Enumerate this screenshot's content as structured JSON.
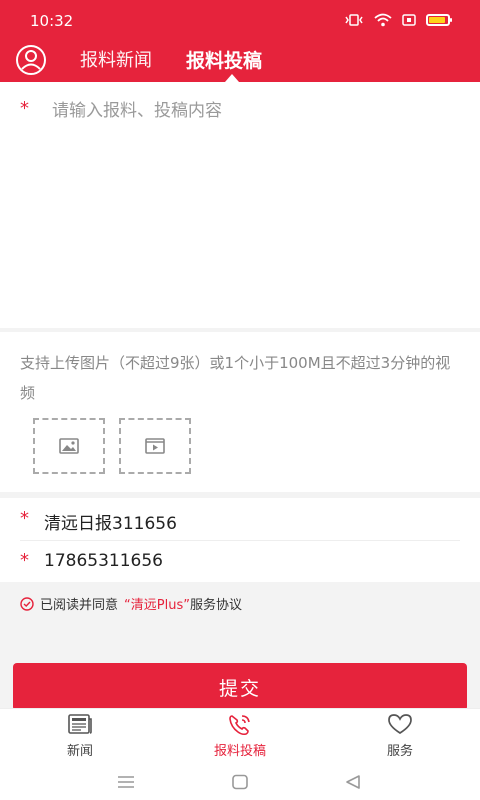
{
  "status": {
    "time": "10:32"
  },
  "header": {
    "tabs": [
      {
        "label": "报料新闻"
      },
      {
        "label": "报料投稿"
      }
    ]
  },
  "form": {
    "content_placeholder": "请输入报料、投稿内容",
    "required_mark": "*",
    "upload_hint": "支持上传图片（不超过9张）或1个小于100M且不超过3分钟的视频",
    "name_value": "清远日报311656",
    "phone_value": "17865311656"
  },
  "agreement": {
    "prefix": "已阅读并同意",
    "link": "“清远Plus”",
    "suffix": "服务协议"
  },
  "submit_label": "提交",
  "bottom_nav": [
    {
      "label": "新闻"
    },
    {
      "label": "报料投稿"
    },
    {
      "label": "服务"
    }
  ],
  "colors": {
    "accent": "#e6233c"
  }
}
